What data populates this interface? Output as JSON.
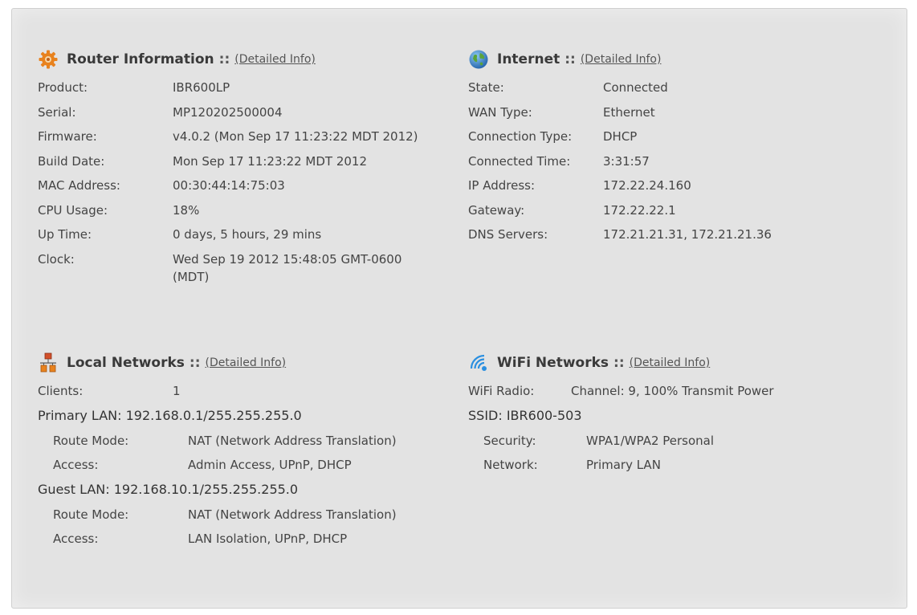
{
  "router": {
    "title": "Router Information",
    "sep": "::",
    "link": "(Detailed Info)",
    "rows": [
      {
        "label": "Product:",
        "value": "IBR600LP"
      },
      {
        "label": "Serial:",
        "value": "MP120202500004"
      },
      {
        "label": "Firmware:",
        "value": "v4.0.2 (Mon Sep 17 11:23:22 MDT 2012)"
      },
      {
        "label": "Build Date:",
        "value": "Mon Sep 17 11:23:22 MDT 2012"
      },
      {
        "label": "MAC Address:",
        "value": "00:30:44:14:75:03"
      },
      {
        "label": "CPU Usage:",
        "value": "18%"
      },
      {
        "label": "Up Time:",
        "value": "0 days, 5 hours, 29 mins"
      },
      {
        "label": "Clock:",
        "value": "Wed Sep 19 2012 15:48:05 GMT-0600 (MDT)"
      }
    ]
  },
  "internet": {
    "title": "Internet",
    "sep": "::",
    "link": "(Detailed Info)",
    "rows": [
      {
        "label": "State:",
        "value": "Connected"
      },
      {
        "label": "WAN Type:",
        "value": "Ethernet"
      },
      {
        "label": "Connection Type:",
        "value": "DHCP"
      },
      {
        "label": "Connected Time:",
        "value": "3:31:57"
      },
      {
        "label": "IP Address:",
        "value": "172.22.24.160"
      },
      {
        "label": "Gateway:",
        "value": "172.22.22.1"
      },
      {
        "label": "DNS Servers:",
        "value": "172.21.21.31, 172.21.21.36"
      }
    ]
  },
  "local": {
    "title": "Local Networks",
    "sep": "::",
    "link": "(Detailed Info)",
    "clients_label": "Clients:",
    "clients_value": "1",
    "primary": {
      "heading": "Primary LAN: 192.168.0.1/255.255.255.0",
      "route_label": "Route Mode:",
      "route_value": "NAT (Network Address Translation)",
      "access_label": "Access:",
      "access_value": "Admin Access, UPnP, DHCP"
    },
    "guest": {
      "heading": "Guest LAN: 192.168.10.1/255.255.255.0",
      "route_label": "Route Mode:",
      "route_value": "NAT (Network Address Translation)",
      "access_label": "Access:",
      "access_value": "LAN Isolation, UPnP, DHCP"
    }
  },
  "wifi": {
    "title": "WiFi Networks",
    "sep": "::",
    "link": "(Detailed Info)",
    "radio_label": "WiFi Radio:",
    "radio_value": "Channel: 9, 100% Transmit Power",
    "ssid": "SSID: IBR600-503",
    "security_label": "Security:",
    "security_value": "WPA1/WPA2 Personal",
    "network_label": "Network:",
    "network_value": "Primary LAN"
  },
  "icons": {
    "router": "gear-icon",
    "internet": "globe-icon",
    "local": "network-icon",
    "wifi": "wifi-icon"
  },
  "colors": {
    "panel_bg": "#e3e3e3",
    "gear": "#e8821e",
    "globe": "#2f7fc6",
    "network": "#d2502a",
    "wifi": "#2b8fe0"
  }
}
